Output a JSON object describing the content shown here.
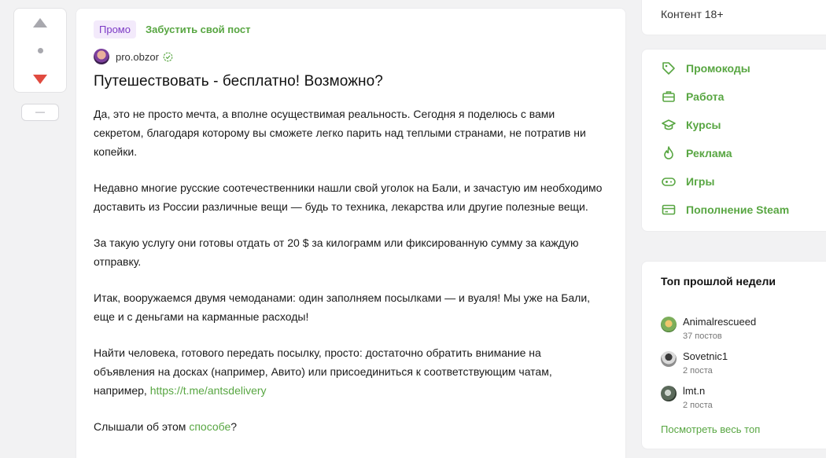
{
  "vote": {
    "collapse_label": "—"
  },
  "post": {
    "promo_badge": "Промо",
    "boost_link": "Забустить свой пост",
    "author": "pro.obzor",
    "title": "Путешествовать - бесплатно! Возможно?",
    "paragraphs": [
      "Да, это не просто мечта, а вполне осуществимая реальность. Сегодня я поделюсь с вами секретом, благодаря которому вы сможете легко парить над теплыми странами, не потратив ни копейки.",
      "Недавно многие русские соотечественники нашли свой уголок на Бали, и зачастую им необходимо доставить из России различные вещи — будь то техника, лекарства или другие полезные вещи.",
      "За такую услугу они готовы отдать от 20 $ за килограмм или фиксированную сумму за каждую отправку.",
      "Итак, вооружаемся двумя чемоданами: один заполняем посылками — и вуаля! Мы уже на Бали, еще и с деньгами на карманные расходы!"
    ],
    "p5_text": "Найти человека, готового передать посылку, просто: достаточно обратить внимание на объявления на досках (например, Авито) или присоединиться к соответствующим чатам, например, ",
    "p5_link": "https://t.me/antsdelivery",
    "p6_text": "Слышали об этом ",
    "p6_link": "способе",
    "p6_end": "?"
  },
  "sidebar": {
    "content18": "Контент 18+",
    "menu": [
      {
        "label": "Промокоды",
        "icon": "tag-icon"
      },
      {
        "label": "Работа",
        "icon": "briefcase-icon"
      },
      {
        "label": "Курсы",
        "icon": "graduation-cap-icon"
      },
      {
        "label": "Реклама",
        "icon": "flame-icon"
      },
      {
        "label": "Игры",
        "icon": "gamepad-icon"
      },
      {
        "label": "Пополнение Steam",
        "icon": "card-icon"
      }
    ],
    "top_week": {
      "title": "Топ прошлой недели",
      "users": [
        {
          "name": "Animalrescueed",
          "count": "37 постов"
        },
        {
          "name": "Sovetnic1",
          "count": "2 поста"
        },
        {
          "name": "lmt.n",
          "count": "2 поста"
        }
      ],
      "see_all": "Посмотреть весь топ"
    }
  },
  "colors": {
    "accent": "#58a642",
    "downvote": "#e04a3f",
    "promo": "#7d3cc6"
  }
}
